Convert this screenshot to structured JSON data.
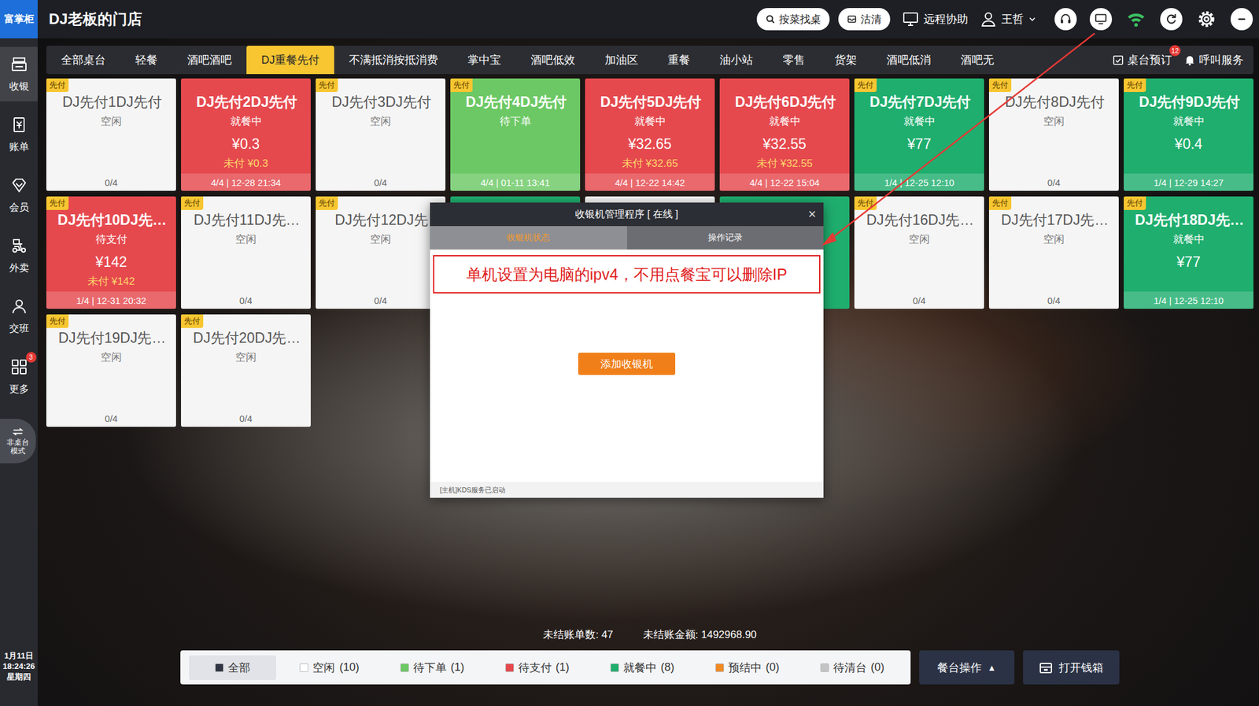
{
  "app": {
    "logo": "富掌柜",
    "store": "DJ老板的门店"
  },
  "topbar": {
    "search": "按菜找桌",
    "soldout": "沽清",
    "remote": "远程协助",
    "user": "王哲"
  },
  "categories": [
    {
      "label": "全部桌台",
      "selected": false
    },
    {
      "label": "轻餐",
      "selected": false
    },
    {
      "label": "酒吧酒吧",
      "selected": false
    },
    {
      "label": "DJ重餐先付",
      "selected": true
    },
    {
      "label": "不满抵消按抵消费",
      "selected": false
    },
    {
      "label": "掌中宝",
      "selected": false
    },
    {
      "label": "酒吧低效",
      "selected": false
    },
    {
      "label": "加油区",
      "selected": false
    },
    {
      "label": "重餐",
      "selected": false
    },
    {
      "label": "油小站",
      "selected": false
    },
    {
      "label": "零售",
      "selected": false
    },
    {
      "label": "货架",
      "selected": false
    },
    {
      "label": "酒吧低消",
      "selected": false
    },
    {
      "label": "酒吧无",
      "selected": false
    }
  ],
  "top_actions": [
    {
      "label": "桌台预订",
      "badge": "12"
    },
    {
      "label": "呼叫服务",
      "badge": ""
    }
  ],
  "sidebar": {
    "items": [
      {
        "label": "收银",
        "selected": true,
        "badge": ""
      },
      {
        "label": "账单",
        "selected": false,
        "badge": ""
      },
      {
        "label": "会员",
        "selected": false,
        "badge": ""
      },
      {
        "label": "外卖",
        "selected": false,
        "badge": ""
      },
      {
        "label": "交班",
        "selected": false,
        "badge": ""
      },
      {
        "label": "更多",
        "selected": false,
        "badge": "3"
      }
    ],
    "mode_toggle": "非桌台模式",
    "date": "1月11日",
    "time": "18:24:26",
    "weekday": "星期四"
  },
  "tables": [
    {
      "name": "DJ先付1DJ先付",
      "tag": "先付",
      "status": "空闲",
      "amount": "",
      "unpaid": "",
      "footer": "0/4",
      "color": "#f5f5f5",
      "covered": false
    },
    {
      "name": "DJ先付2DJ先付",
      "tag": "",
      "status": "就餐中",
      "amount": "¥0.3",
      "unpaid": "未付 ¥0.3",
      "footer": "4/4 | 12-28 21:34",
      "color": "#e5494e",
      "covered": false
    },
    {
      "name": "DJ先付3DJ先付",
      "tag": "先付",
      "status": "空闲",
      "amount": "",
      "unpaid": "",
      "footer": "0/4",
      "color": "#f5f5f5",
      "covered": false
    },
    {
      "name": "DJ先付4DJ先付",
      "tag": "先付",
      "status": "待下单",
      "amount": "",
      "unpaid": "",
      "footer": "4/4 | 01-11 13:41",
      "color": "#6cc864",
      "covered": false
    },
    {
      "name": "DJ先付5DJ先付",
      "tag": "",
      "status": "就餐中",
      "amount": "¥32.65",
      "unpaid": "未付 ¥32.65",
      "footer": "4/4 | 12-22 14:42",
      "color": "#e5494e",
      "covered": false
    },
    {
      "name": "DJ先付6DJ先付",
      "tag": "",
      "status": "就餐中",
      "amount": "¥32.55",
      "unpaid": "未付 ¥32.55",
      "footer": "4/4 | 12-22 15:04",
      "color": "#e5494e",
      "covered": false
    },
    {
      "name": "DJ先付7DJ先付",
      "tag": "先付",
      "status": "就餐中",
      "amount": "¥77",
      "unpaid": "",
      "footer": "1/4 | 12-25 12:10",
      "color": "#1fae6e",
      "covered": false
    },
    {
      "name": "DJ先付8DJ先付",
      "tag": "先付",
      "status": "空闲",
      "amount": "",
      "unpaid": "",
      "footer": "0/4",
      "color": "#f5f5f5",
      "covered": false
    },
    {
      "name": "DJ先付9DJ先付",
      "tag": "先付",
      "status": "就餐中",
      "amount": "¥0.4",
      "unpaid": "",
      "footer": "1/4 | 12-29 14:27",
      "color": "#1fae6e",
      "covered": false
    },
    {
      "name": "DJ先付10DJ先…",
      "tag": "先付",
      "status": "待支付",
      "amount": "¥142",
      "unpaid": "未付 ¥142",
      "footer": "1/4 | 12-31 20:32",
      "color": "#e5494e",
      "covered": false
    },
    {
      "name": "DJ先付11DJ先…",
      "tag": "先付",
      "status": "空闲",
      "amount": "",
      "unpaid": "",
      "footer": "0/4",
      "color": "#f5f5f5",
      "covered": false
    },
    {
      "name": "DJ先付12DJ先",
      "tag": "先付",
      "status": "空闲",
      "amount": "",
      "unpaid": "",
      "footer": "0/4",
      "color": "#f5f5f5",
      "covered": false
    },
    {
      "name": "",
      "tag": "",
      "status": "",
      "amount": "",
      "unpaid": "",
      "footer": "",
      "color": "#1fae6e",
      "covered": true
    },
    {
      "name": "",
      "tag": "",
      "status": "",
      "amount": "",
      "unpaid": "",
      "footer": "",
      "color": "#f5f5f5",
      "covered": true
    },
    {
      "name": "",
      "tag": "",
      "status": "",
      "amount": "",
      "unpaid": "",
      "footer": "",
      "color": "#1fae6e",
      "covered": true
    },
    {
      "name": "DJ先付16DJ先…",
      "tag": "先付",
      "status": "空闲",
      "amount": "",
      "unpaid": "",
      "footer": "0/4",
      "color": "#f5f5f5",
      "covered": false
    },
    {
      "name": "DJ先付17DJ先…",
      "tag": "先付",
      "status": "空闲",
      "amount": "",
      "unpaid": "",
      "footer": "0/4",
      "color": "#f5f5f5",
      "covered": false
    },
    {
      "name": "DJ先付18DJ先…",
      "tag": "先付",
      "status": "就餐中",
      "amount": "¥77",
      "unpaid": "",
      "footer": "1/4 | 12-25 12:10",
      "color": "#1fae6e",
      "covered": false
    },
    {
      "name": "DJ先付19DJ先…",
      "tag": "先付",
      "status": "空闲",
      "amount": "",
      "unpaid": "",
      "footer": "0/4",
      "color": "#f5f5f5",
      "covered": false
    },
    {
      "name": "DJ先付20DJ先…",
      "tag": "先付",
      "status": "空闲",
      "amount": "",
      "unpaid": "",
      "footer": "0/4",
      "color": "#f5f5f5",
      "covered": false
    }
  ],
  "summary": {
    "bills": "未结账单数: 47",
    "amount": "未结账金额: 1492968.90"
  },
  "filters": [
    {
      "label": "全部",
      "count": "",
      "selected": true,
      "color": "#2f3542"
    },
    {
      "label": "空闲",
      "count": "(10)",
      "selected": false,
      "color": "#ffffff"
    },
    {
      "label": "待下单",
      "count": "(1)",
      "selected": false,
      "color": "#6cc864"
    },
    {
      "label": "待支付",
      "count": "(1)",
      "selected": false,
      "color": "#e5494e"
    },
    {
      "label": "就餐中",
      "count": "(8)",
      "selected": false,
      "color": "#1fae6e"
    },
    {
      "label": "预结中",
      "count": "(0)",
      "selected": false,
      "color": "#f08a24"
    },
    {
      "label": "待清台",
      "count": "(0)",
      "selected": false,
      "color": "#c4c4c4"
    }
  ],
  "buttons": {
    "table_ops": "餐台操作",
    "table_ops_arrow": "▲",
    "cash_drawer": "打开钱箱"
  },
  "dialog": {
    "title": "收银机管理程序 [ 在线 ]",
    "close": "×",
    "tabs": [
      {
        "label": "收银机状态",
        "selected": true
      },
      {
        "label": "操作记录",
        "selected": false
      }
    ],
    "note": "单机设置为电脑的ipv4，不用点餐宝可以删除IP",
    "button": "添加收银机",
    "footer": "[主机]KDS服务已启动"
  }
}
